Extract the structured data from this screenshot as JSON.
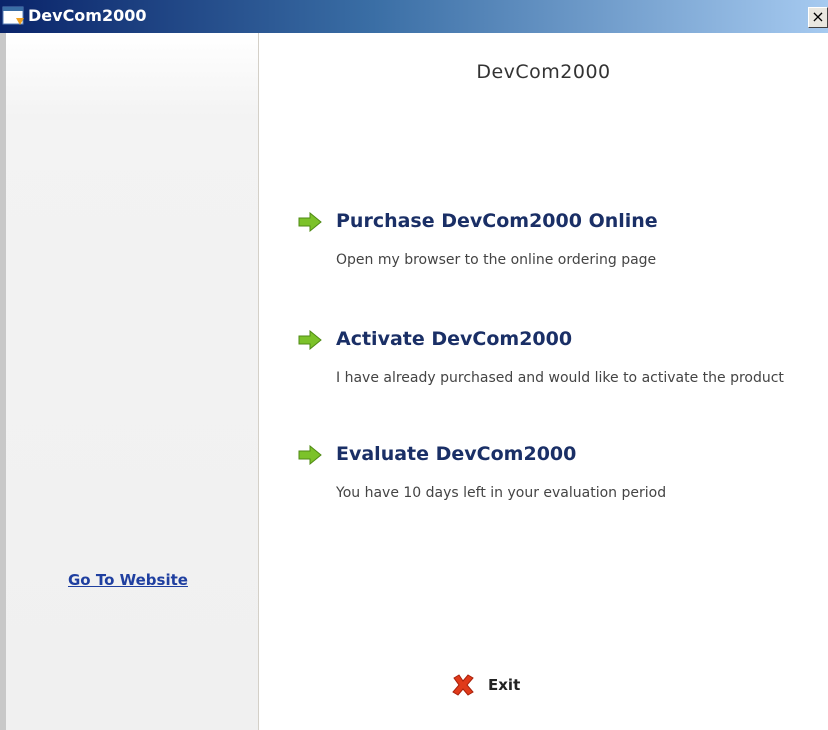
{
  "window": {
    "title": "DevCom2000",
    "close_glyph": "×"
  },
  "sidebar": {
    "link": "Go To Website"
  },
  "main": {
    "heading": "DevCom2000",
    "options": [
      {
        "title": "Purchase DevCom2000 Online",
        "description": "Open my browser to the online ordering page",
        "icon": "green-arrow-icon"
      },
      {
        "title": "Activate DevCom2000",
        "description": "I have already purchased and would like to activate the product",
        "icon": "green-arrow-icon"
      },
      {
        "title": "Evaluate DevCom2000",
        "description": "You have 10 days left in your evaluation period",
        "icon": "green-arrow-icon"
      }
    ],
    "exit_label": "Exit"
  },
  "colors": {
    "title_gradient_start": "#0a246a",
    "link": "#1f3fa0",
    "option_title": "#1a2f66",
    "arrow": "#7cc22a",
    "exit_icon": "#e03a1a"
  }
}
